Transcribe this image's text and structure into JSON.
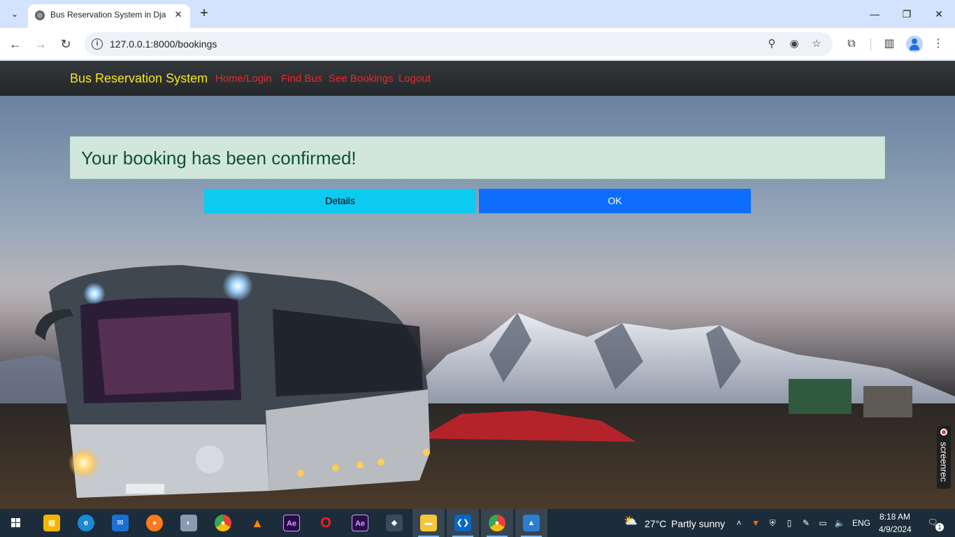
{
  "browser": {
    "tab_title": "Bus Reservation System in Djan",
    "url": "127.0.0.1:8000/bookings"
  },
  "navbar": {
    "brand": "Bus Reservation System",
    "links": [
      "Home/Login",
      "Find Bus",
      "See Bookings",
      "Logout"
    ]
  },
  "alert": {
    "message": "Your booking has been confirmed!"
  },
  "buttons": {
    "details": "Details",
    "ok": "OK"
  },
  "overlay": {
    "screenrec": "screenrec"
  },
  "taskbar": {
    "apps": [
      "windows-start",
      "microsoft-store",
      "edge",
      "mail",
      "firefox",
      "photos-app",
      "chrome",
      "vlc",
      "after-effects",
      "opera",
      "after-effects",
      "inkscape",
      "file-explorer",
      "vscode",
      "chrome",
      "photos"
    ],
    "weather_temp": "27°C",
    "weather_text": "Partly sunny",
    "language": "ENG",
    "time": "8:18 AM",
    "date": "4/9/2024",
    "notification_count": "1"
  },
  "colors": {
    "brand": "#f6e71d",
    "nav_link": "#e8272a",
    "alert_bg": "#d1e7dd",
    "alert_text": "#0f5132",
    "details_btn": "#0dcaf0",
    "ok_btn": "#0d6efd"
  }
}
